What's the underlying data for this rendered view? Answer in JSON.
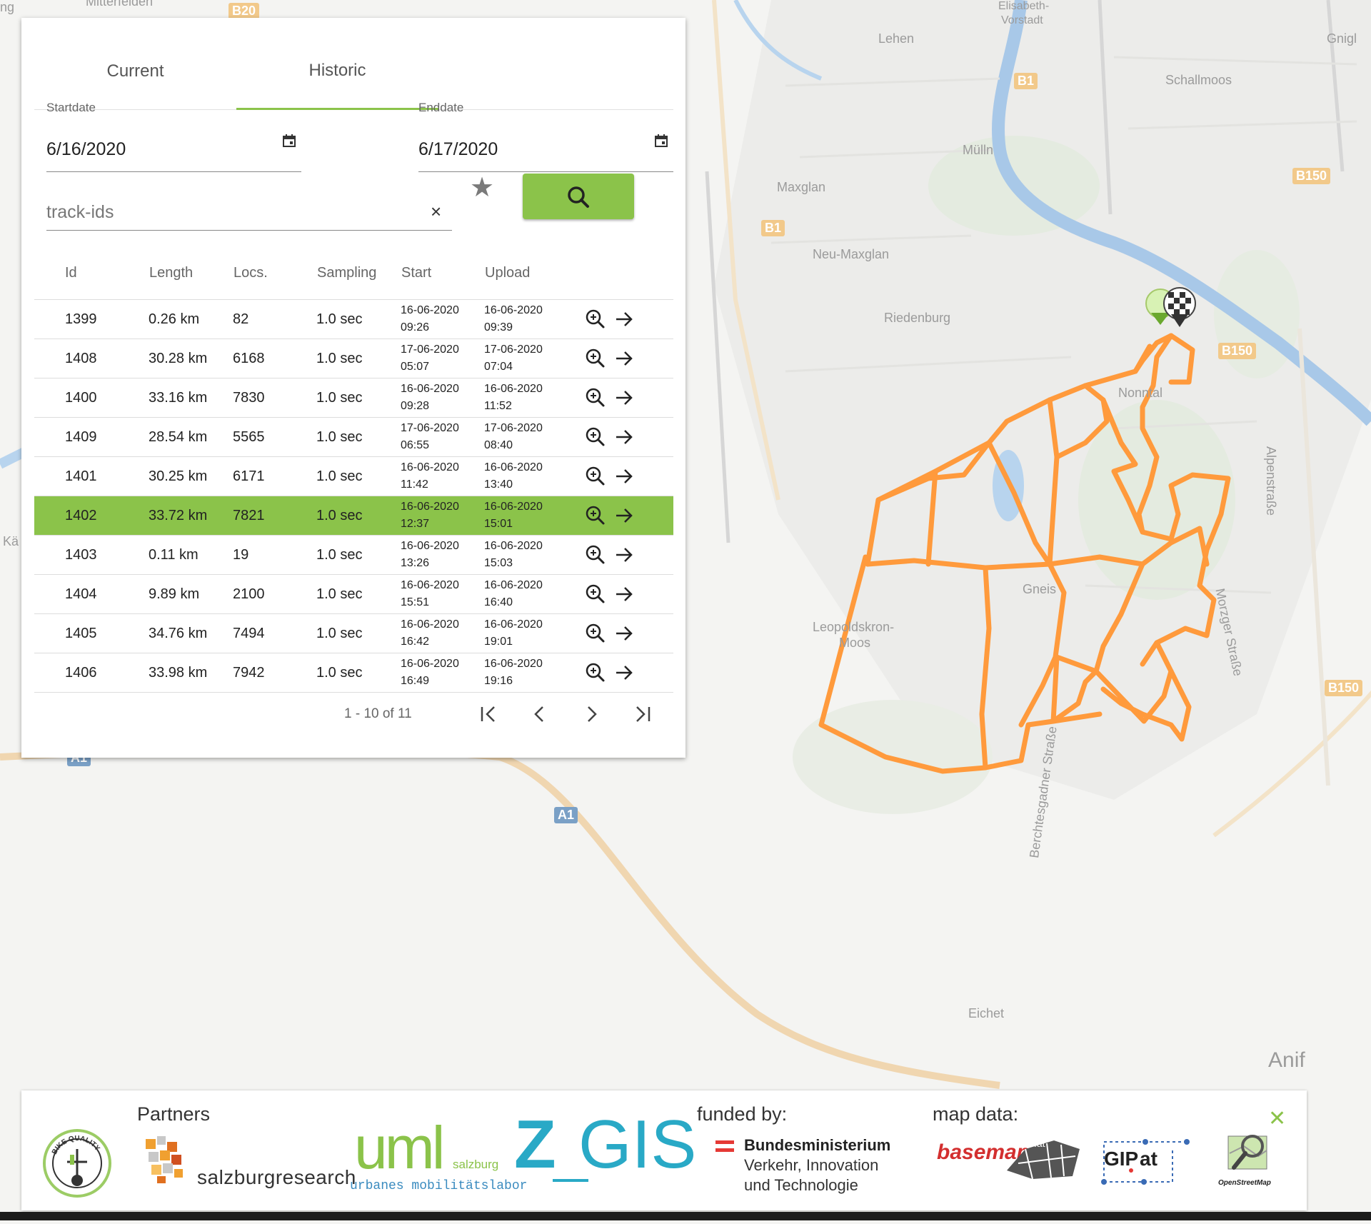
{
  "tabs": {
    "current": "Current",
    "historic": "Historic",
    "active": "historic"
  },
  "filters": {
    "start_label": "Startdate",
    "start_value": "6/16/2020",
    "end_label": "Enddate",
    "end_value": "6/17/2020",
    "trackids_placeholder": "track-ids",
    "clear_glyph": "×",
    "star_glyph": "★"
  },
  "table": {
    "headers": [
      "Id",
      "Length",
      "Locs.",
      "Sampling",
      "Start",
      "Upload"
    ],
    "rows": [
      {
        "id": "1399",
        "length": "0.26 km",
        "locs": "82",
        "sampling": "1.0 sec",
        "start_date": "16-06-2020",
        "start_time": "09:26",
        "upload_date": "16-06-2020",
        "upload_time": "09:39",
        "selected": false
      },
      {
        "id": "1408",
        "length": "30.28 km",
        "locs": "6168",
        "sampling": "1.0 sec",
        "start_date": "17-06-2020",
        "start_time": "05:07",
        "upload_date": "17-06-2020",
        "upload_time": "07:04",
        "selected": false
      },
      {
        "id": "1400",
        "length": "33.16 km",
        "locs": "7830",
        "sampling": "1.0 sec",
        "start_date": "16-06-2020",
        "start_time": "09:28",
        "upload_date": "16-06-2020",
        "upload_time": "11:52",
        "selected": false
      },
      {
        "id": "1409",
        "length": "28.54 km",
        "locs": "5565",
        "sampling": "1.0 sec",
        "start_date": "17-06-2020",
        "start_time": "06:55",
        "upload_date": "17-06-2020",
        "upload_time": "08:40",
        "selected": false
      },
      {
        "id": "1401",
        "length": "30.25 km",
        "locs": "6171",
        "sampling": "1.0 sec",
        "start_date": "16-06-2020",
        "start_time": "11:42",
        "upload_date": "16-06-2020",
        "upload_time": "13:40",
        "selected": false
      },
      {
        "id": "1402",
        "length": "33.72 km",
        "locs": "7821",
        "sampling": "1.0 sec",
        "start_date": "16-06-2020",
        "start_time": "12:37",
        "upload_date": "16-06-2020",
        "upload_time": "15:01",
        "selected": true
      },
      {
        "id": "1403",
        "length": "0.11 km",
        "locs": "19",
        "sampling": "1.0 sec",
        "start_date": "16-06-2020",
        "start_time": "13:26",
        "upload_date": "16-06-2020",
        "upload_time": "15:03",
        "selected": false
      },
      {
        "id": "1404",
        "length": "9.89 km",
        "locs": "2100",
        "sampling": "1.0 sec",
        "start_date": "16-06-2020",
        "start_time": "15:51",
        "upload_date": "16-06-2020",
        "upload_time": "16:40",
        "selected": false
      },
      {
        "id": "1405",
        "length": "34.76 km",
        "locs": "7494",
        "sampling": "1.0 sec",
        "start_date": "16-06-2020",
        "start_time": "16:42",
        "upload_date": "16-06-2020",
        "upload_time": "19:01",
        "selected": false
      },
      {
        "id": "1406",
        "length": "33.98 km",
        "locs": "7942",
        "sampling": "1.0 sec",
        "start_date": "16-06-2020",
        "start_time": "16:49",
        "upload_date": "16-06-2020",
        "upload_time": "19:16",
        "selected": false
      }
    ],
    "paginator": "1 - 10 of 11"
  },
  "map": {
    "track_color": "#ff9a3c",
    "labels": [
      "Lehen",
      "Elisabeth-",
      "Vorstadt",
      "Schallmoos",
      "Gnigl",
      "Mülln",
      "Maxglan",
      "Neu-Maxglan",
      "Riedenburg",
      "Nonntal",
      "Alpenstraße",
      "Gneis",
      "Leopoldskron-",
      "Moos",
      "Morzger Straße",
      "Berchtesgadner Straße",
      "Eichet",
      "Anif",
      "Kä",
      "ng",
      "Mitterfelden"
    ],
    "shields": [
      "B20",
      "B1",
      "B1",
      "B150",
      "B150",
      "B150",
      "A1",
      "A1"
    ]
  },
  "footer": {
    "partners_title": "Partners",
    "funded_title": "funded by:",
    "mapdata_title": "map data:",
    "bike_quality": "BIKE QUALITY",
    "salzburg_research": "salzburgresearch",
    "uml_word": "uml",
    "uml_salzburg": "salzburg",
    "uml_sub": "urbanes mobilitätslabor",
    "zgis_z": "Z",
    "zgis_rest": "GIS",
    "ministry": [
      "Bundesministerium",
      "Verkehr, Innovation",
      "und Technologie"
    ],
    "basemap": "basemap",
    "basemap_at": ".at",
    "gip": "GIP",
    "gip_at": "at",
    "osm": "OpenStreetMap",
    "close_glyph": "✕"
  }
}
